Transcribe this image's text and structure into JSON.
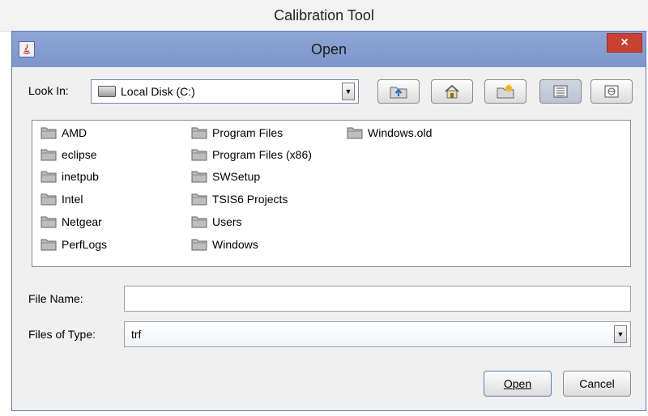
{
  "app": {
    "title": "Calibration Tool"
  },
  "dialog": {
    "title": "Open",
    "close_label": "×",
    "look_in_label": "Look In:",
    "look_in_value": "Local Disk (C:)",
    "toolbar": {
      "up_icon": "folder-up-icon",
      "home_icon": "home-icon",
      "new_folder_icon": "new-folder-icon",
      "list_view_icon": "list-view-icon",
      "details_view_icon": "details-view-icon"
    },
    "files": [
      "AMD",
      "eclipse",
      "inetpub",
      "Intel",
      "Netgear",
      "PerfLogs",
      "Program Files",
      "Program Files (x86)",
      "SWSetup",
      "TSIS6 Projects",
      "Users",
      "Windows",
      "Windows.old"
    ],
    "file_name_label": "File Name:",
    "file_name_value": "",
    "files_of_type_label": "Files of Type:",
    "files_of_type_value": "trf",
    "open_label": "Open",
    "cancel_label": "Cancel"
  },
  "colors": {
    "titlebar": "#7d96cb",
    "close": "#c84234",
    "folder": "#8c8c8c"
  }
}
